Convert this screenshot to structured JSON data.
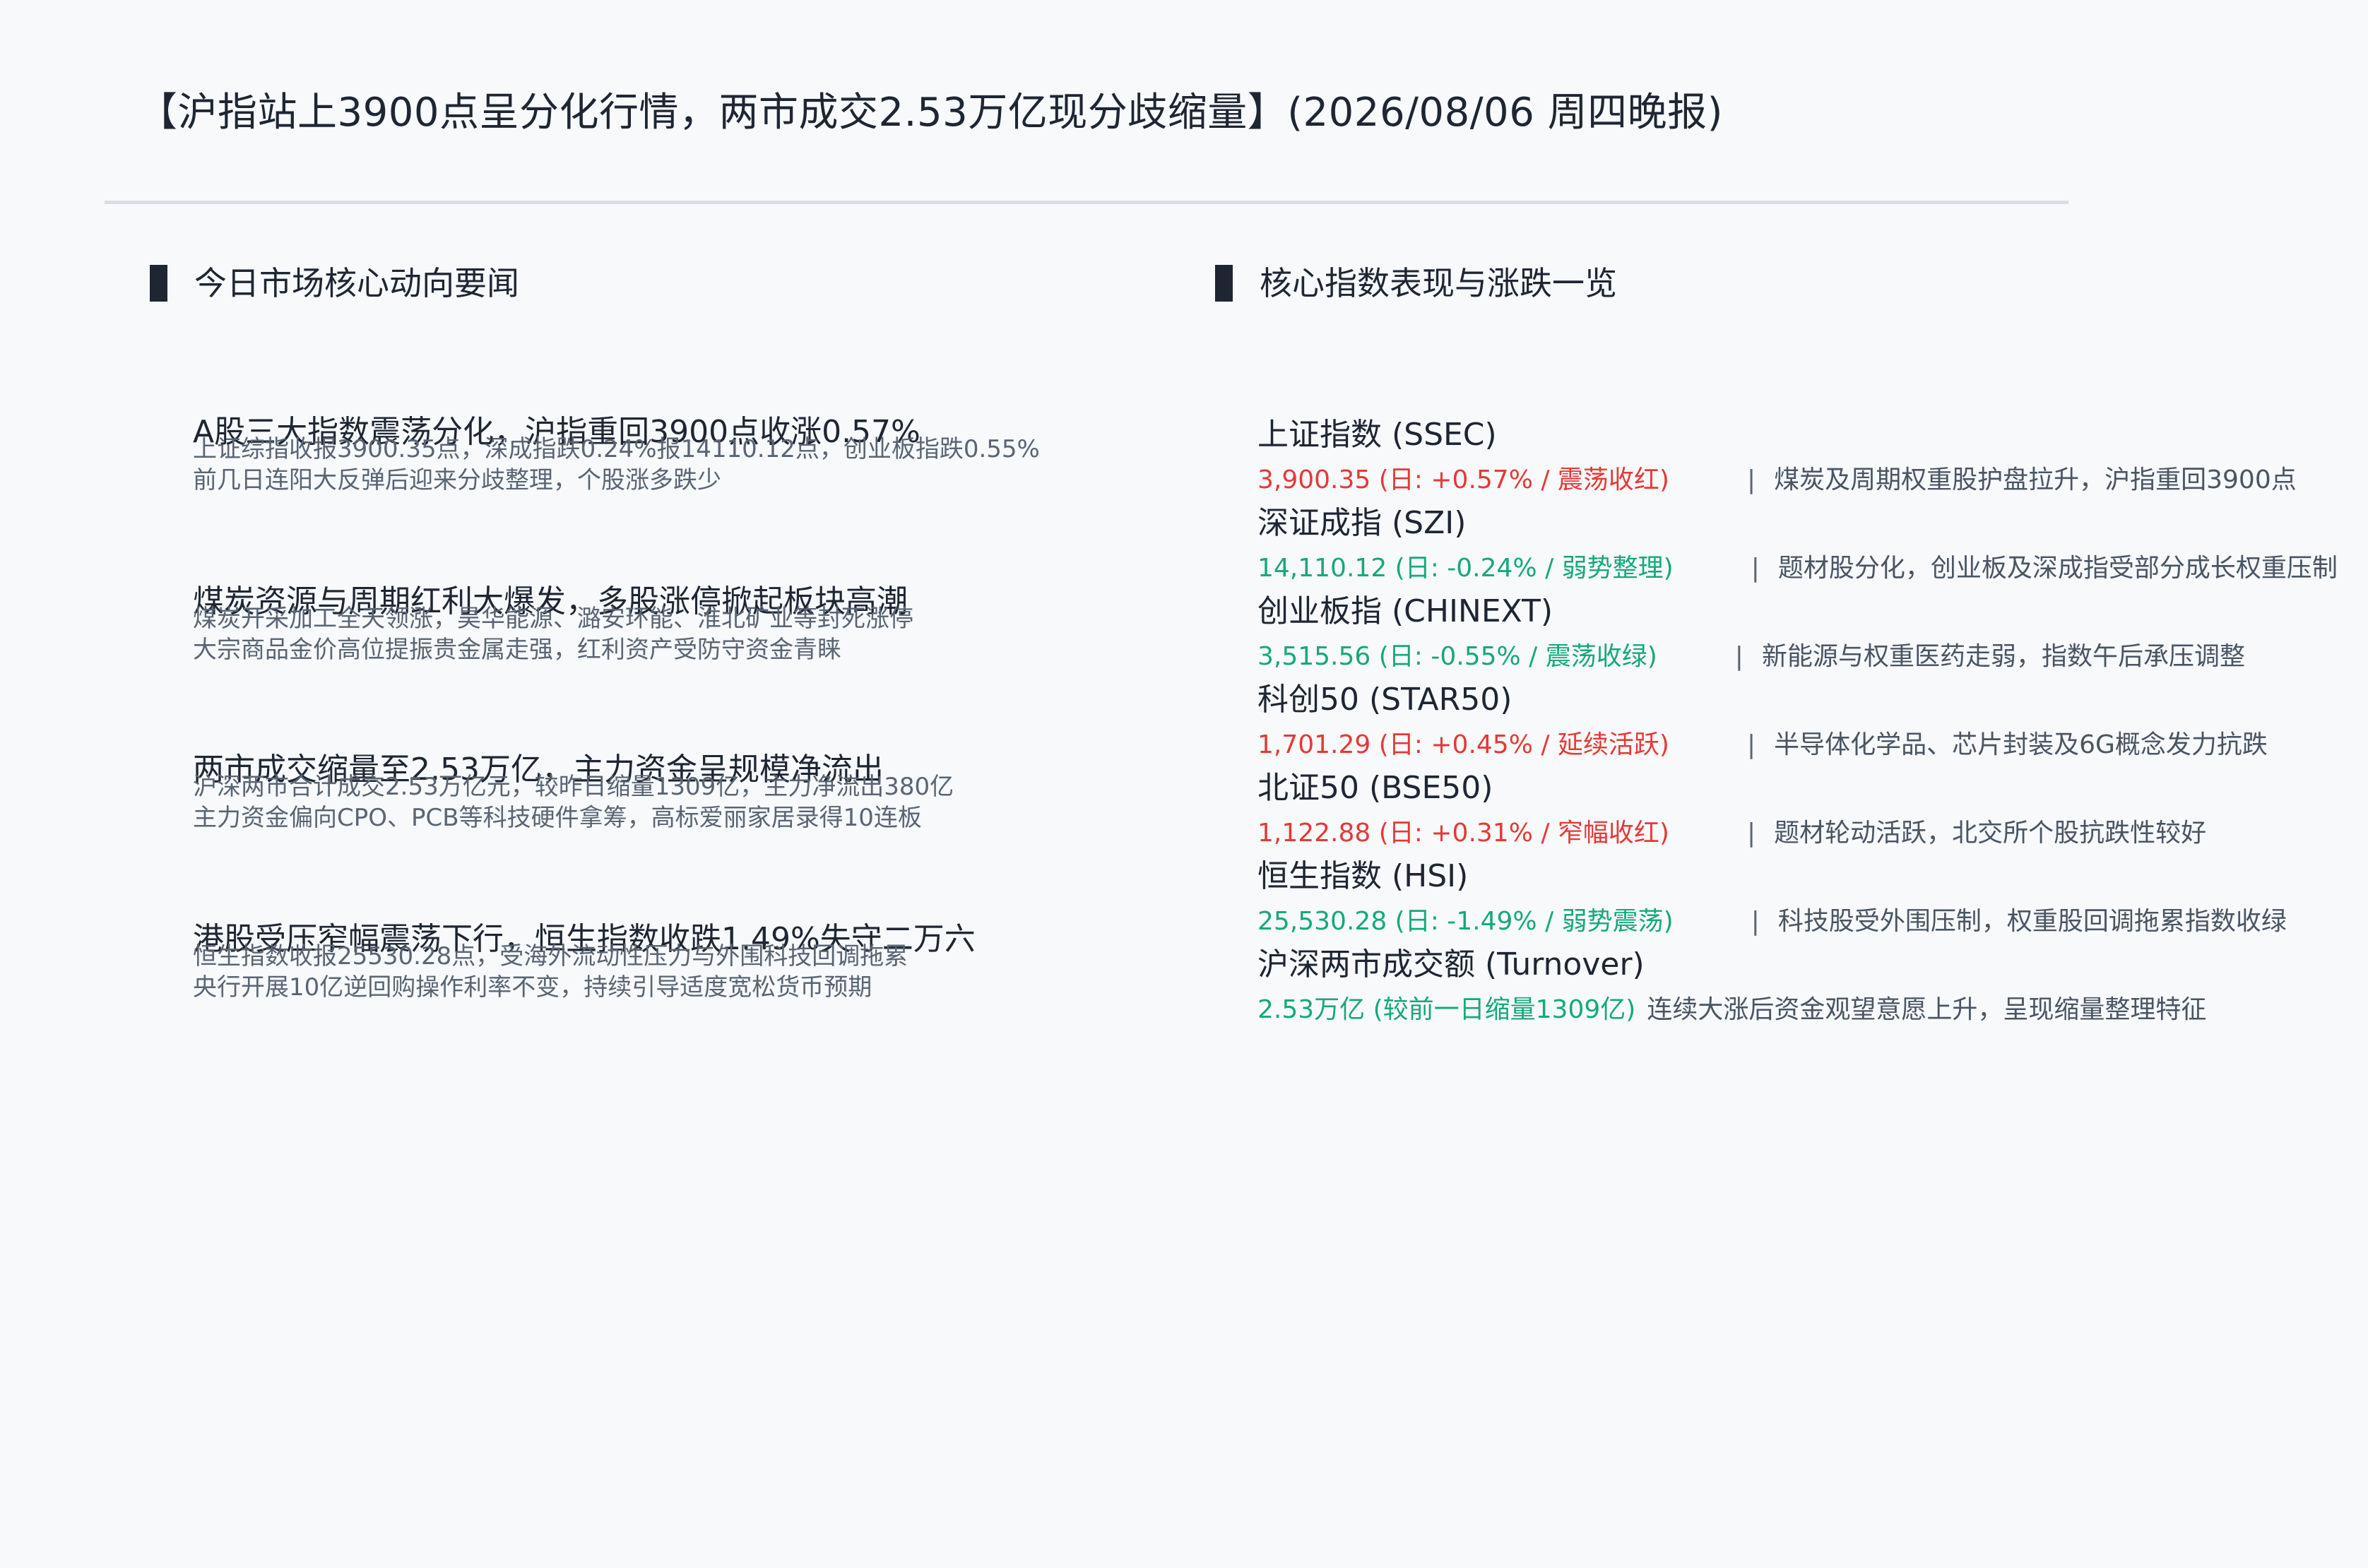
{
  "title": "【沪指站上3900点呈分化行情，两市成交2.53万亿现分歧缩量】(2026/08/06 周四晚报)",
  "left_section": {
    "heading": "今日市场核心动向要闻",
    "items": [
      {
        "title": "A股三大指数震荡分化，沪指重回3900点收涨0.57%",
        "line1": "上证综指收报3900.35点，深成指跌0.24%报14110.12点，创业板指跌0.55%",
        "line2": "前几日连阳大反弹后迎来分歧整理，个股涨多跌少"
      },
      {
        "title": "煤炭资源与周期红利大爆发，多股涨停掀起板块高潮",
        "line1": "煤炭开采加工全天领涨，昊华能源、潞安环能、淮北矿业等封死涨停",
        "line2": "大宗商品金价高位提振贵金属走强，红利资产受防守资金青睐"
      },
      {
        "title": "两市成交缩量至2.53万亿，主力资金呈规模净流出",
        "line1": "沪深两市合计成交2.53万亿元，较昨日缩量1309亿，主力净流出380亿",
        "line2": "主力资金偏向CPO、PCB等科技硬件拿筹，高标爱丽家居录得10连板"
      },
      {
        "title": "港股受压窄幅震荡下行，恒生指数收跌1.49%失守二万六",
        "line1": "恒生指数收报25530.28点，受海外流动性压力与外围科技回调拖累",
        "line2": "央行开展10亿逆回购操作利率不变，持续引导适度宽松货币预期"
      }
    ]
  },
  "right_section": {
    "heading": "核心指数表现与涨跌一览",
    "indices": [
      {
        "name": "上证指数 (SSEC)",
        "value": "3,900.35 (日: +0.57% / 震荡收红)",
        "direction": "up",
        "separator": "|",
        "comment": "煤炭及周期权重股护盘拉升，沪指重回3900点"
      },
      {
        "name": "深证成指 (SZI)",
        "value": "14,110.12 (日: -0.24% / 弱势整理)",
        "direction": "down",
        "separator": "|",
        "comment": "题材股分化，创业板及深成指受部分成长权重压制"
      },
      {
        "name": "创业板指 (CHINEXT)",
        "value": "3,515.56 (日: -0.55% / 震荡收绿)",
        "direction": "down",
        "separator": "|",
        "comment": "新能源与权重医药走弱，指数午后承压调整"
      },
      {
        "name": "科创50 (STAR50)",
        "value": "1,701.29 (日: +0.45% / 延续活跃)",
        "direction": "up",
        "separator": "|",
        "comment": "半导体化学品、芯片封装及6G概念发力抗跌"
      },
      {
        "name": "北证50 (BSE50)",
        "value": "1,122.88 (日: +0.31% / 窄幅收红)",
        "direction": "up",
        "separator": "|",
        "comment": "题材轮动活跃，北交所个股抗跌性较好"
      },
      {
        "name": "恒生指数 (HSI)",
        "value": "25,530.28 (日: -1.49% / 弱势震荡)",
        "direction": "down",
        "separator": "|",
        "comment": "科技股受外围压制，权重股回调拖累指数收绿"
      }
    ],
    "turnover": {
      "name": "沪深两市成交额 (Turnover)",
      "value": "2.53万亿 (较前一日缩量1309亿)",
      "direction": "down",
      "comment": "连续大涨后资金观望意愿上升，呈现缩量整理特征"
    }
  },
  "colors": {
    "up": "#e53935",
    "down": "#16a87c",
    "text": "#1e2633",
    "muted": "#5a6573",
    "divider": "#d7dee6"
  }
}
